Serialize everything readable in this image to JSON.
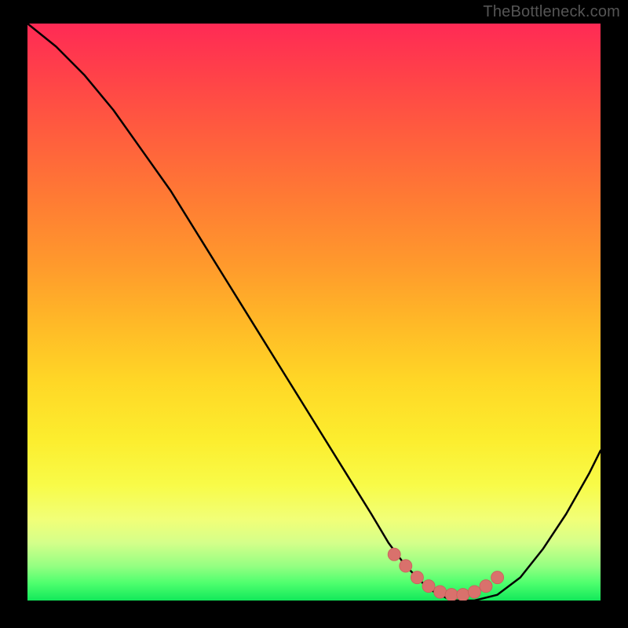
{
  "watermark": "TheBottleneck.com",
  "chart_data": {
    "type": "line",
    "title": "",
    "xlabel": "",
    "ylabel": "",
    "xlim": [
      0,
      100
    ],
    "ylim": [
      0,
      100
    ],
    "grid": false,
    "legend": false,
    "gradient_stops": [
      {
        "pos": 0,
        "color": "#ff2a55"
      },
      {
        "pos": 8,
        "color": "#ff3f4a"
      },
      {
        "pos": 18,
        "color": "#ff5a3f"
      },
      {
        "pos": 30,
        "color": "#ff7a34"
      },
      {
        "pos": 42,
        "color": "#ff9a2c"
      },
      {
        "pos": 52,
        "color": "#ffb927"
      },
      {
        "pos": 62,
        "color": "#ffd726"
      },
      {
        "pos": 72,
        "color": "#fced2e"
      },
      {
        "pos": 80,
        "color": "#f8fb48"
      },
      {
        "pos": 86,
        "color": "#f1ff78"
      },
      {
        "pos": 90,
        "color": "#d4ff8a"
      },
      {
        "pos": 94,
        "color": "#95ff82"
      },
      {
        "pos": 97,
        "color": "#4eff6e"
      },
      {
        "pos": 100,
        "color": "#12e85a"
      }
    ],
    "series": [
      {
        "name": "bottleneck-curve",
        "x": [
          0,
          5,
          10,
          15,
          20,
          25,
          30,
          35,
          40,
          45,
          50,
          55,
          60,
          63,
          66,
          70,
          74,
          78,
          82,
          86,
          90,
          94,
          98,
          100
        ],
        "y": [
          100,
          96,
          91,
          85,
          78,
          71,
          63,
          55,
          47,
          39,
          31,
          23,
          15,
          10,
          6,
          2,
          0,
          0,
          1,
          4,
          9,
          15,
          22,
          26
        ]
      }
    ],
    "markers": {
      "name": "optimal-zone",
      "x": [
        64,
        66,
        68,
        70,
        72,
        74,
        76,
        78,
        80,
        82
      ],
      "y": [
        8,
        6,
        4,
        2.5,
        1.5,
        1,
        1,
        1.5,
        2.5,
        4
      ]
    }
  }
}
